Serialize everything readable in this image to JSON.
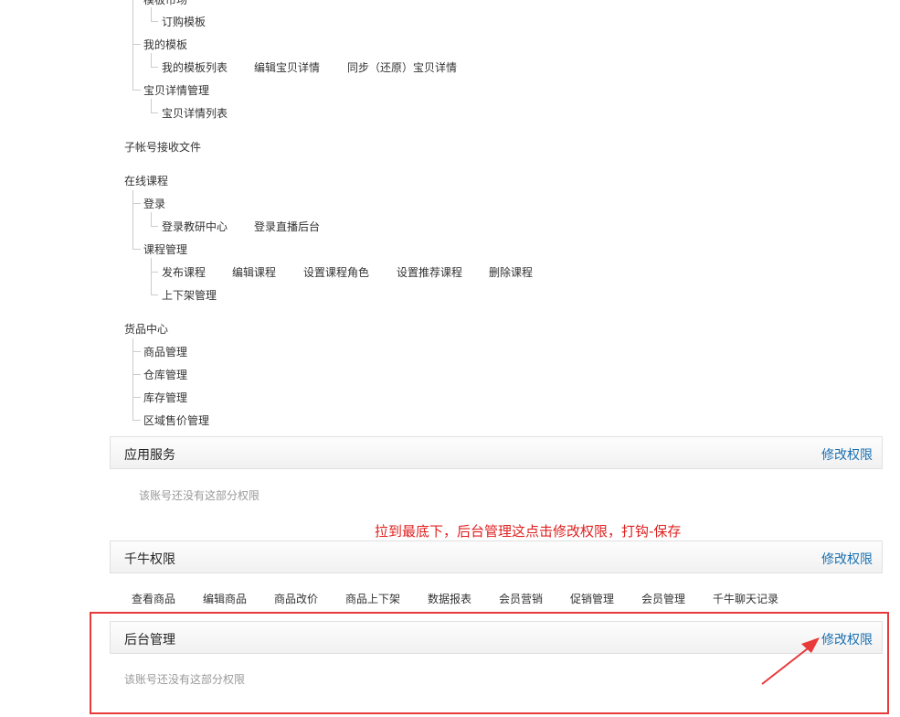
{
  "tree": {
    "top_cut_label": "模板市场",
    "template_market_child": "订购模板",
    "my_templates": "我的模板",
    "my_templates_children": [
      "我的模板列表",
      "编辑宝贝详情",
      "同步（还原）宝贝详情"
    ],
    "item_detail_mgmt": "宝贝详情管理",
    "item_detail_list": "宝贝详情列表",
    "subaccount_files": "子帐号接收文件",
    "online_courses": "在线课程",
    "login": "登录",
    "login_children": [
      "登录教研中心",
      "登录直播后台"
    ],
    "course_mgmt": "课程管理",
    "course_mgmt_children": [
      "发布课程",
      "编辑课程",
      "设置课程角色",
      "设置推荐课程",
      "删除课程"
    ],
    "shelf_mgmt": "上下架管理",
    "goods_center": "货品中心",
    "goods_children": [
      "商品管理",
      "仓库管理",
      "库存管理",
      "区域售价管理"
    ]
  },
  "sections": {
    "app_service": {
      "title": "应用服务",
      "link": "修改权限",
      "empty": "该账号还没有这部分权限"
    },
    "qianniu": {
      "title": "千牛权限",
      "link": "修改权限",
      "perms": [
        "查看商品",
        "编辑商品",
        "商品改价",
        "商品上下架",
        "数据报表",
        "会员营销",
        "促销管理",
        "会员管理",
        "千牛聊天记录"
      ]
    },
    "backend": {
      "title": "后台管理",
      "link": "修改权限",
      "empty": "该账号还没有这部分权限"
    }
  },
  "annotation": "拉到最底下，后台管理这点击修改权限，打钩-保存",
  "colors": {
    "annotation_red": "#e02020",
    "link_blue": "#1a6fb0"
  }
}
